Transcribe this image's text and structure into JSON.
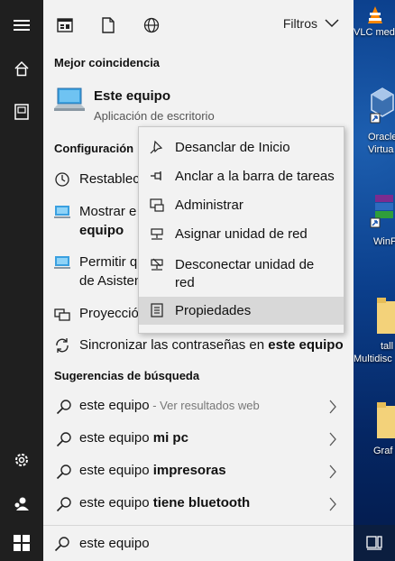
{
  "rail": {
    "icons": [
      "hamburger-icon",
      "home-icon",
      "documents-icon",
      "settings-icon",
      "user-icon"
    ]
  },
  "topbar": {
    "filters_label": "Filtros"
  },
  "best_match": {
    "heading": "Mejor coincidencia",
    "title": "Este equipo",
    "subtitle": "Aplicación de escritorio"
  },
  "config": {
    "heading": "Configuración",
    "items": [
      {
        "line1": "Restablec"
      },
      {
        "line1": "Mostrar e",
        "line2": "equipo"
      },
      {
        "line1": "Permitir q",
        "line2": "de Asisten"
      },
      {
        "line1": "Proyecció"
      },
      {
        "prefix": "Sincronizar las contraseñas en ",
        "bold": "este equipo"
      }
    ]
  },
  "suggestions": {
    "heading": "Sugerencias de búsqueda",
    "items": [
      {
        "base": "este equipo",
        "extra": " - Ver resultados web",
        "bold": ""
      },
      {
        "base": "este equipo ",
        "extra": "",
        "bold": "mi pc"
      },
      {
        "base": "este equipo ",
        "extra": "",
        "bold": "impresoras"
      },
      {
        "base": "este equipo ",
        "extra": "",
        "bold": "tiene bluetooth"
      }
    ]
  },
  "context_menu": {
    "items": [
      {
        "label": "Desanclar de Inicio",
        "icon": "unpin-icon"
      },
      {
        "label": "Anclar a la barra de tareas",
        "icon": "pin-taskbar-icon"
      },
      {
        "label": "Administrar",
        "icon": "manage-icon"
      },
      {
        "label": "Asignar unidad de red",
        "icon": "map-drive-icon"
      },
      {
        "label_line1": "Desconectar unidad de",
        "label_line2": "red",
        "icon": "disconnect-drive-icon"
      },
      {
        "label": "Propiedades",
        "icon": "properties-icon",
        "highlighted": true
      }
    ]
  },
  "search": {
    "value": "este equipo"
  },
  "desktop": {
    "labels": [
      "VLC med",
      "Oracle",
      "Virtua",
      "WinF",
      "tall",
      "Multidisc",
      "Graf"
    ]
  },
  "colors": {
    "rail": "#1f1f1f",
    "panel": "#f2f2f2",
    "highlight": "#d8d8d8",
    "desktop": "#0b3f8c"
  }
}
